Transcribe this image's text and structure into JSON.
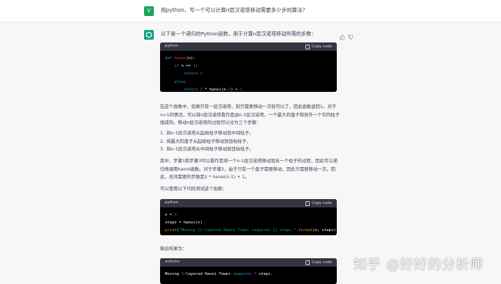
{
  "user": {
    "avatar_letter": "V",
    "message": "用python，写一个可以计算n层汉诺塔移动需要多少步的算法?"
  },
  "assistant": {
    "intro": "以下是一个递归的Python函数，用于计算n层汉诺塔移动所需的步数：",
    "code1": {
      "lang": "python",
      "copy": "Copy code",
      "lines": [
        "def hanoi(n):",
        "    if n == 1:",
        "        return 1",
        "    else:",
        "        return 2 * hanoi(n-1) + 1"
      ]
    },
    "para1": "在这个函数中，如果只有一层汉诺塔，则只需要移动一次就可以了，因此函数返回1。对于n>1的情况，可以将n层汉诺塔看作是由n-1层汉诺塔，一个最大的盘子和另外一个空的柱子组成的。移动n层汉诺塔的过程可以分为三个步骤：",
    "steps": [
      {
        "num": "1.",
        "text": "将n-1层汉诺塔从起始柱子移动到中间柱子。"
      },
      {
        "num": "2.",
        "text": "将最大的盘子从起始柱子移动到目标柱子。"
      },
      {
        "num": "3.",
        "text": "将n-1层汉诺塔从中间柱子移动到目标柱子。"
      }
    ],
    "para2": "其中，步骤1和步骤3可以看作是将一个n-1层汉诺塔移动到另一个柱子的过程，因此可以递归地调用hanoi函数。对于步骤2，由于只有一个盘子需要移动，因此只需要移动一次。因此，总共需要的步数是2 * hanoi(n-1) + 1。",
    "para3": "可以使用以下代码测试这个函数：",
    "code2": {
      "lang": "python",
      "copy": "Copy code",
      "lines": [
        "n = 3",
        "steps = hanoi(n)",
        "print(\"Moving {}-layered Hanoi Tower requires {} steps.\".format(n, steps))"
      ]
    },
    "para4": "输出结果为：",
    "code3": {
      "lang": "arduino",
      "copy": "Copy code",
      "lines": [
        "Moving 3-layered Hanoi Tower requires 7 steps."
      ]
    }
  },
  "watermark": "知乎 @好好的分析师",
  "colors": {
    "user_avatar": "#19a55b",
    "gpt_avatar": "#10a37f",
    "code_bg": "#000000",
    "code_header": "#343541"
  }
}
